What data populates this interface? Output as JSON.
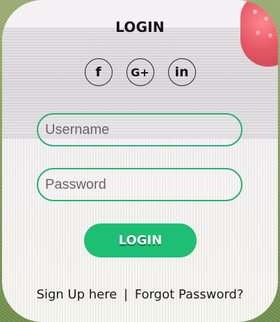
{
  "title": "LOGIN",
  "social": [
    {
      "label": "f",
      "icon": "facebook-icon"
    },
    {
      "label": "G+",
      "icon": "google-plus-icon"
    },
    {
      "label": "in",
      "icon": "linkedin-icon"
    }
  ],
  "form": {
    "username_placeholder": "Username",
    "password_placeholder": "Password",
    "login_label": "LOGIN"
  },
  "footer": {
    "signup_label": "Sign Up here",
    "separator": "|",
    "forgot_label": "Forgot Password?"
  },
  "colors": {
    "accent": "#1cbf73"
  }
}
